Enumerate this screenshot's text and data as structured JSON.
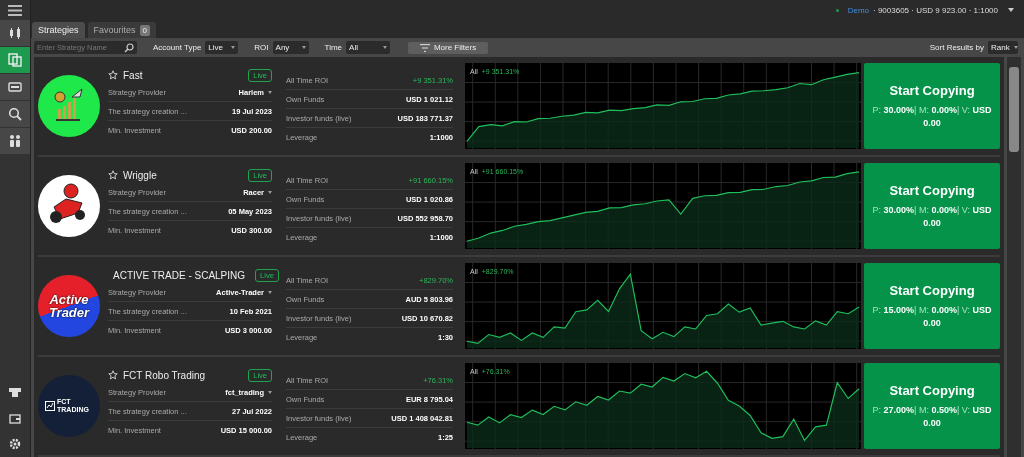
{
  "account": {
    "mode": "Demo",
    "details": "· 9003605 · USD 9 923.00 · 1:1000"
  },
  "sidebar": {
    "items": [
      {
        "selected": false
      },
      {
        "selected": true
      },
      {
        "selected": false
      },
      {
        "selected": false
      },
      {
        "selected": false
      }
    ]
  },
  "tabs": [
    {
      "label": "Strategies",
      "selected": true
    },
    {
      "label": "Favourites",
      "selected": false,
      "count": "0"
    }
  ],
  "filters": {
    "search_placeholder": "Enter Strategy Name",
    "dropdowns": [
      {
        "label": "Account Type",
        "value": "Live"
      },
      {
        "label": "ROI",
        "value": "Any"
      },
      {
        "label": "Time",
        "value": "All"
      }
    ],
    "more_button": "More Filters",
    "sort_label": "Sort Results by",
    "sort_value": "Rank"
  },
  "strategies": [
    {
      "name": "Fast",
      "badge": "Live",
      "left": [
        {
          "kind": "link",
          "label": "Strategy Provider",
          "value": "Harlem"
        },
        {
          "kind": "plain",
          "label": "The strategy creation ...",
          "value": "19 Jul 2023"
        },
        {
          "kind": "plain",
          "label": "Min. Investment",
          "value": "USD 200.00"
        }
      ],
      "right": [
        {
          "kind": "gain",
          "label": "All Time ROI",
          "value": "+9 351.31%"
        },
        {
          "kind": "plain",
          "label": "Own Funds",
          "value": "USD 1 021.12"
        },
        {
          "kind": "plain",
          "label": "Investor funds (live)",
          "value": "USD 183 771.37"
        },
        {
          "kind": "plain",
          "label": "Leverage",
          "value": "1:1000"
        }
      ],
      "chart_label": "All",
      "chart_roi": "+9 351.31%",
      "button": "Start Copying",
      "terms": "P: **30.00%**| M: **0.00%**| V: **USD 0.00**"
    },
    {
      "name": "Wriggle",
      "badge": "Live",
      "left": [
        {
          "kind": "link",
          "label": "Strategy Provider",
          "value": "Racer"
        },
        {
          "kind": "plain",
          "label": "The strategy creation ...",
          "value": "05 May 2023"
        },
        {
          "kind": "plain",
          "label": "Min. Investment",
          "value": "USD 300.00"
        }
      ],
      "right": [
        {
          "kind": "gain",
          "label": "All Time ROI",
          "value": "+91 660.15%"
        },
        {
          "kind": "plain",
          "label": "Own Funds",
          "value": "USD 1 020.86"
        },
        {
          "kind": "plain",
          "label": "Investor funds (live)",
          "value": "USD 552 958.70"
        },
        {
          "kind": "plain",
          "label": "Leverage",
          "value": "1:1000"
        }
      ],
      "chart_label": "All",
      "chart_roi": "+91 660.15%",
      "button": "Start Copying",
      "terms": "P: **30.00%**| M: **0.00%**| V: **USD 0.00**"
    },
    {
      "name": "ACTIVE TRADE - SCALPING",
      "logo_text": "Active Trader",
      "badge": "Live",
      "left": [
        {
          "kind": "link",
          "label": "Strategy Provider",
          "value": "Active-Trader"
        },
        {
          "kind": "plain",
          "label": "The strategy creation ...",
          "value": "10 Feb 2021"
        },
        {
          "kind": "plain",
          "label": "Min. Investment",
          "value": "USD 3 000.00"
        }
      ],
      "right": [
        {
          "kind": "gain",
          "label": "All Time ROI",
          "value": "+829.70%"
        },
        {
          "kind": "plain",
          "label": "Own Funds",
          "value": "AUD 5 803.96"
        },
        {
          "kind": "plain",
          "label": "Investor funds (live)",
          "value": "USD 10 670.82"
        },
        {
          "kind": "plain",
          "label": "Leverage",
          "value": "1:30"
        }
      ],
      "chart_label": "All",
      "chart_roi": "+829.70%",
      "button": "Start Copying",
      "terms": "P: **15.00%**| M: **0.00%**| V: **USD 0.00**"
    },
    {
      "name": "FCT Robo Trading",
      "logo_text": "FCT TRADING",
      "badge": "Live",
      "left": [
        {
          "kind": "link",
          "label": "Strategy Provider",
          "value": "fct_trading"
        },
        {
          "kind": "plain",
          "label": "The strategy creation ...",
          "value": "27 Jul 2022"
        },
        {
          "kind": "plain",
          "label": "Min. Investment",
          "value": "USD 15 000.00"
        }
      ],
      "right": [
        {
          "kind": "gain",
          "label": "All Time ROI",
          "value": "+76.31%"
        },
        {
          "kind": "plain",
          "label": "Own Funds",
          "value": "EUR 8 795.04"
        },
        {
          "kind": "plain",
          "label": "Investor funds (live)",
          "value": "USD 1 408 042.81"
        },
        {
          "kind": "plain",
          "label": "Leverage",
          "value": "1:25"
        }
      ],
      "chart_label": "All",
      "chart_roi": "+76.31%",
      "button": "Start Copying",
      "terms": "P: **27.00%**| M: **0.50%**| V: **USD 0.00**"
    }
  ]
}
